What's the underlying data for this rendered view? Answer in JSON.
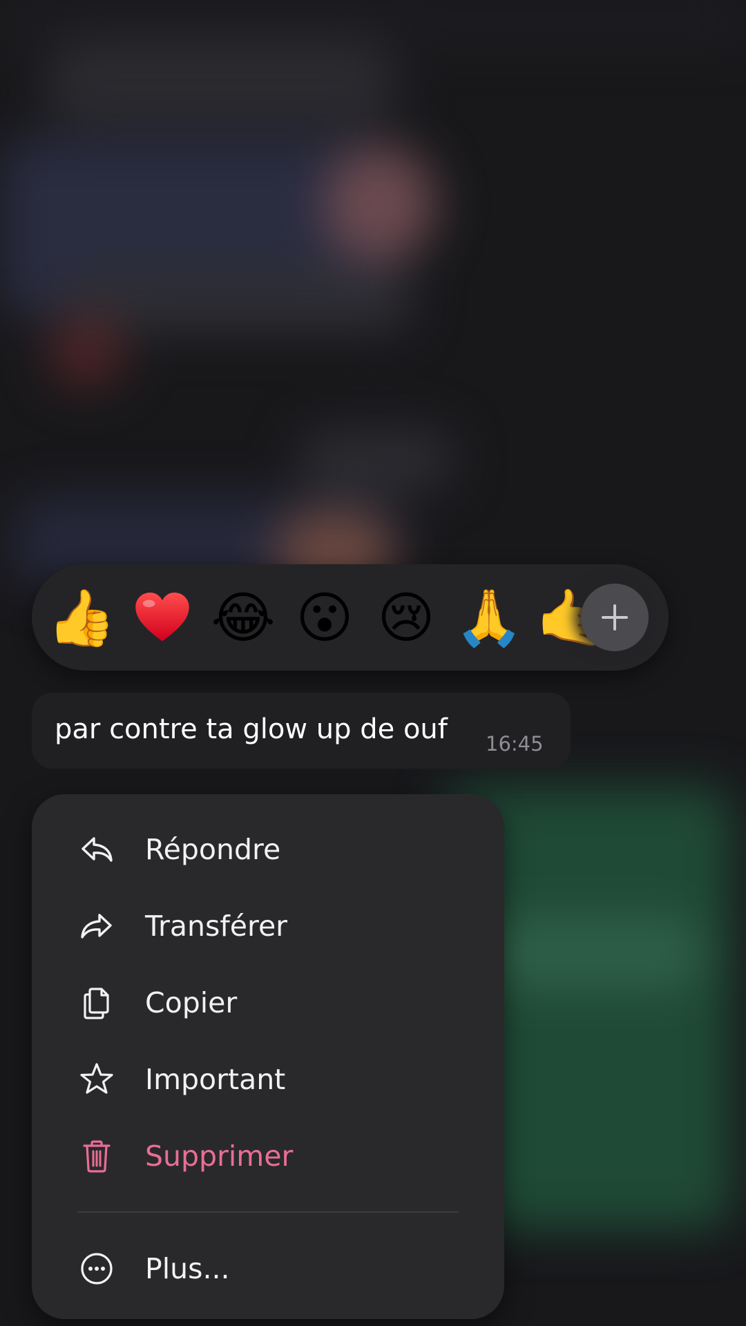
{
  "reactions": {
    "emojis": [
      "👍",
      "❤️",
      "😂",
      "😮",
      "😢",
      "🙏",
      "🤙"
    ],
    "more_icon": "plus-icon"
  },
  "message": {
    "text": "par contre ta glow up de ouf",
    "time": "16:45"
  },
  "menu": {
    "items": [
      {
        "label": "Répondre",
        "icon": "reply-icon"
      },
      {
        "label": "Transférer",
        "icon": "forward-icon"
      },
      {
        "label": "Copier",
        "icon": "copy-icon"
      },
      {
        "label": "Important",
        "icon": "star-icon"
      },
      {
        "label": "Supprimer",
        "icon": "trash-icon"
      },
      {
        "label": "Plus...",
        "icon": "more-icon"
      }
    ]
  },
  "colors": {
    "danger": "#ea6e94",
    "menu_background": "#29292c",
    "bubble_background": "#202023"
  }
}
